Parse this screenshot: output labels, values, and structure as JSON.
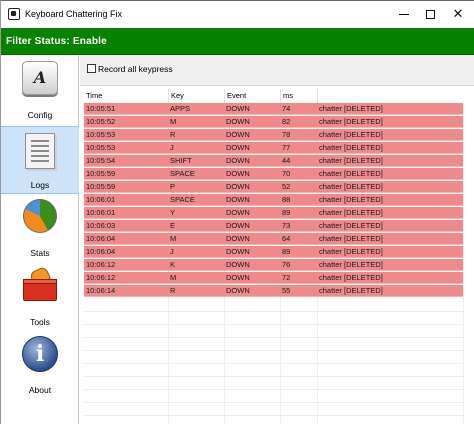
{
  "window": {
    "title": "Keyboard Chattering Fix",
    "controls": {
      "minimize_icon": "minimize-icon",
      "maximize_icon": "maximize-icon",
      "close_icon": "close-icon",
      "close_glyph": "✕"
    }
  },
  "status": {
    "text": "Filter Status: Enable",
    "color": "#068200"
  },
  "sidebar": {
    "items": [
      {
        "label": "Config",
        "icon": "keyboard-key-icon"
      },
      {
        "label": "Logs",
        "icon": "document-icon",
        "active": true
      },
      {
        "label": "Stats",
        "icon": "pie-chart-icon"
      },
      {
        "label": "Tools",
        "icon": "toolbox-icon"
      },
      {
        "label": "About",
        "icon": "info-icon",
        "glyph": "i"
      }
    ],
    "config_glyph": "A"
  },
  "toolbar": {
    "record_all_label": "Record all keypress",
    "record_all_checked": false
  },
  "table": {
    "columns": [
      "Time",
      "Key",
      "Event",
      "ms",
      ""
    ],
    "row_color": "#f08a8a",
    "rows": [
      [
        "10:05:51",
        "APPS",
        "DOWN",
        "74",
        "chatter [DELETED]"
      ],
      [
        "10:05:52",
        "M",
        "DOWN",
        "82",
        "chatter [DELETED]"
      ],
      [
        "10:05:53",
        "R",
        "DOWN",
        "78",
        "chatter [DELETED]"
      ],
      [
        "10:05:53",
        "J",
        "DOWN",
        "77",
        "chatter [DELETED]"
      ],
      [
        "10:05:54",
        "SHIFT",
        "DOWN",
        "44",
        "chatter [DELETED]"
      ],
      [
        "10:05:59",
        "SPACE",
        "DOWN",
        "70",
        "chatter [DELETED]"
      ],
      [
        "10:05:59",
        "P",
        "DOWN",
        "52",
        "chatter [DELETED]"
      ],
      [
        "10:06:01",
        "SPACE",
        "DOWN",
        "88",
        "chatter [DELETED]"
      ],
      [
        "10:06:01",
        "Y",
        "DOWN",
        "89",
        "chatter [DELETED]"
      ],
      [
        "10:06:03",
        "E",
        "DOWN",
        "73",
        "chatter [DELETED]"
      ],
      [
        "10:06:04",
        "M",
        "DOWN",
        "64",
        "chatter [DELETED]"
      ],
      [
        "10:06:04",
        "J",
        "DOWN",
        "89",
        "chatter [DELETED]"
      ],
      [
        "10:06:12",
        "K",
        "DOWN",
        "76",
        "chatter [DELETED]"
      ],
      [
        "10:06:12",
        "M",
        "DOWN",
        "72",
        "chatter [DELETED]"
      ],
      [
        "10:06:14",
        "R",
        "DOWN",
        "55",
        "chatter [DELETED]"
      ]
    ]
  }
}
